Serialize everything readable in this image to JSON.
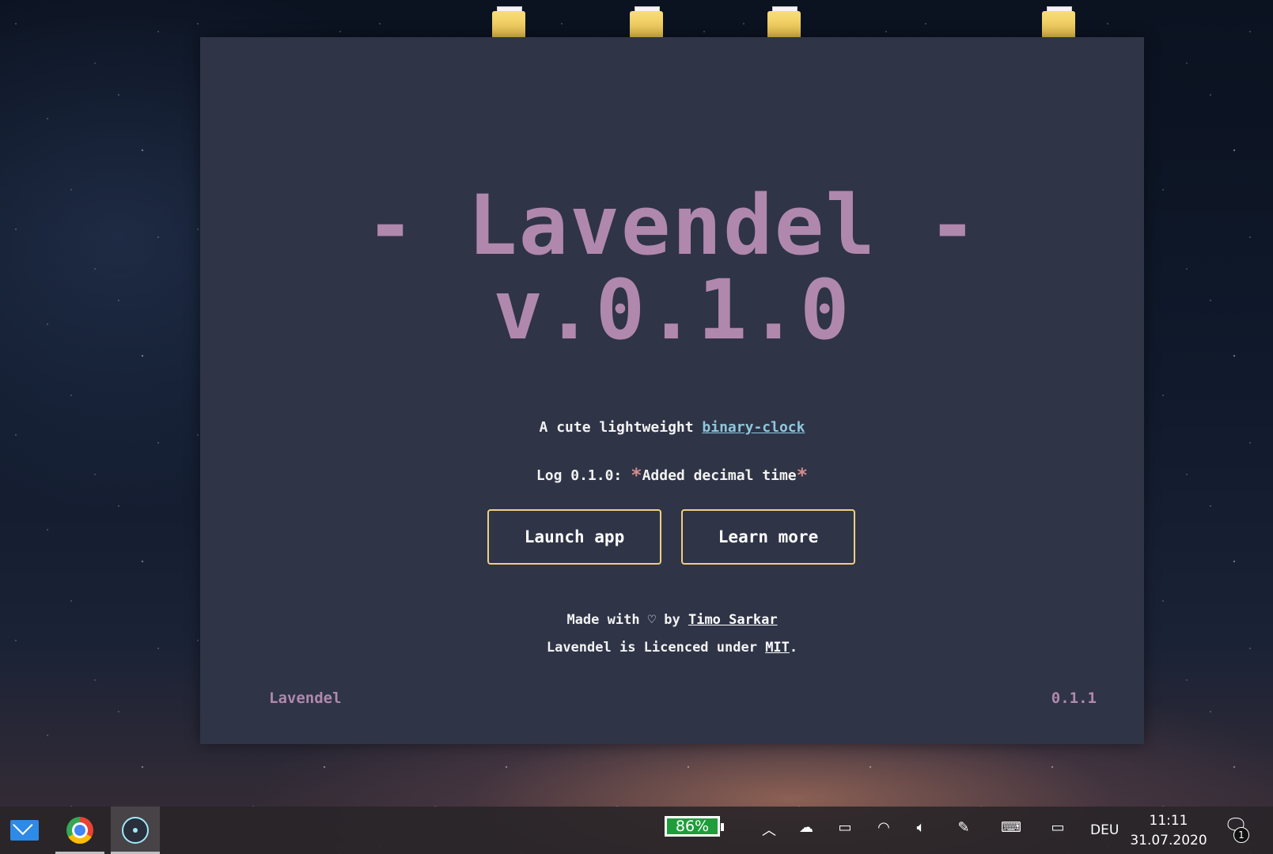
{
  "app": {
    "title_line1": "- Lavendel -",
    "title_line2": "v.0.1.0",
    "tagline_prefix": "A cute lightweight ",
    "tagline_link": "binary-clock",
    "log_prefix": "Log 0.1.0: ",
    "log_text": "Added decimal time",
    "log_asterisk": "*",
    "launch_button": "Launch app",
    "learn_button": "Learn more",
    "made_prefix": "Made with ♡ by ",
    "made_author": "Timo Sarkar",
    "licence_prefix": "Lavendel is Licenced under ",
    "licence_link": "MIT",
    "licence_suffix": ".",
    "footer_name": "Lavendel",
    "footer_version": "0.1.1"
  },
  "colors": {
    "window_bg": "#2f3447",
    "title": "#b088ad",
    "button_border": "#efcf83",
    "link": "#8fc7dc"
  },
  "taskbar": {
    "apps": [
      "mail-icon",
      "chrome-icon",
      "electron-icon"
    ],
    "battery": "86%",
    "language": "DEU",
    "time": "11:11",
    "date": "31.07.2020",
    "notification_count": "1"
  }
}
